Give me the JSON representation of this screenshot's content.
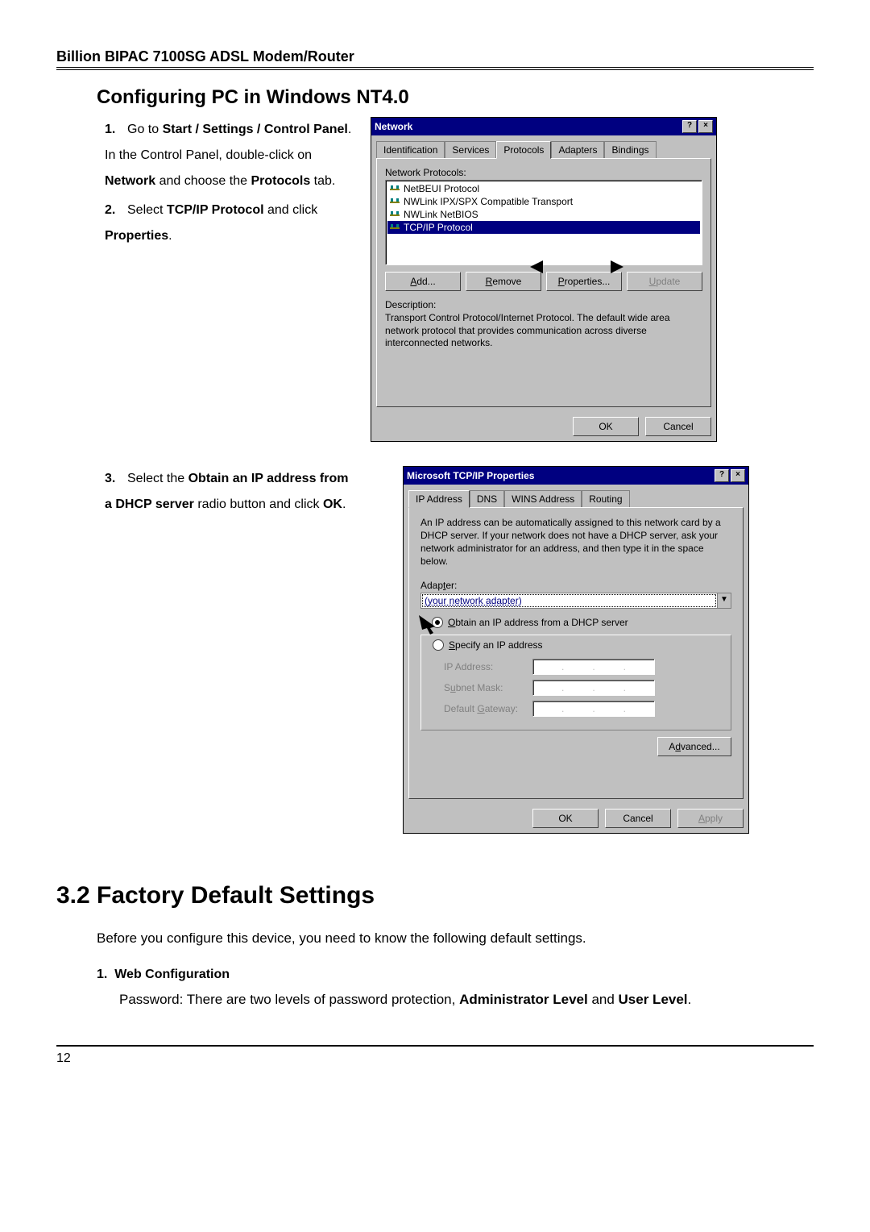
{
  "header": "Billion BIPAC 7100SG ADSL Modem/Router",
  "section_title": "Configuring PC in Windows NT4.0",
  "steps": {
    "s1": {
      "num": "1.",
      "prefix": "Go to ",
      "b1": "Start / Settings / Control Panel",
      "mid1": ". In the Control Panel, double-click on ",
      "b2": "Network",
      "mid2": " and choose the ",
      "b3": "Protocols",
      "suffix": " tab."
    },
    "s2": {
      "num": "2.",
      "prefix": "Select ",
      "b1": "TCP/IP Protocol",
      "mid1": " and click ",
      "b2": "Properties",
      "suffix": "."
    },
    "s3": {
      "num": "3.",
      "prefix": "Select the ",
      "b1": "Obtain an IP address from a DHCP server",
      "mid1": " radio button and click ",
      "b2": "OK",
      "suffix": "."
    }
  },
  "dlg1": {
    "title": "Network",
    "tabs": [
      "Identification",
      "Services",
      "Protocols",
      "Adapters",
      "Bindings"
    ],
    "active_tab": 2,
    "list_label": "Network Protocols:",
    "items": [
      {
        "label": "NetBEUI Protocol",
        "selected": false
      },
      {
        "label": "NWLink IPX/SPX Compatible Transport",
        "selected": false
      },
      {
        "label": "NWLink NetBIOS",
        "selected": false
      },
      {
        "label": "TCP/IP Protocol",
        "selected": true
      }
    ],
    "buttons": {
      "add": "Add...",
      "remove": "Remove",
      "properties": "Properties...",
      "update": "Update"
    },
    "desc_label": "Description:",
    "desc_text": "Transport Control Protocol/Internet Protocol. The default wide area network protocol that provides communication across diverse interconnected networks.",
    "ok": "OK",
    "cancel": "Cancel"
  },
  "dlg2": {
    "title": "Microsoft TCP/IP Properties",
    "tabs": [
      "IP Address",
      "DNS",
      "WINS Address",
      "Routing"
    ],
    "active_tab": 0,
    "info": "An IP address can be automatically assigned to this network card by a DHCP server. If your network does not have a DHCP server, ask your network administrator for an address, and then type it in the space below.",
    "adapter_label": "Adapter:",
    "adapter_value": "(your network adapter)",
    "radio_obtain": "Obtain an IP address from a DHCP server",
    "radio_specify": "Specify an IP address",
    "ip_label": "IP Address:",
    "mask_label": "Subnet Mask:",
    "gw_label": "Default Gateway:",
    "advanced": "Advanced...",
    "ok": "OK",
    "cancel": "Cancel",
    "apply": "Apply"
  },
  "h2": "3.2 Factory Default Settings",
  "body1": "Before you configure this device, you need to know the following default settings.",
  "sub1_num": "1.",
  "sub1_title": "Web Configuration",
  "body2_prefix": "Password: There are two levels of password protection, ",
  "body2_b1": "Administrator Level",
  "body2_mid": " and ",
  "body2_b2": "User Level",
  "body2_suffix": ".",
  "page_number": "12"
}
